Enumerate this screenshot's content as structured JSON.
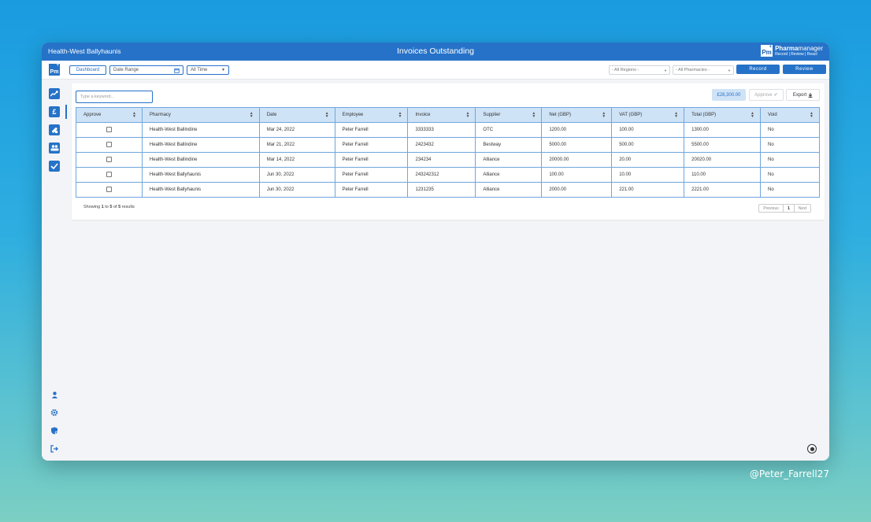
{
  "window": {
    "org": "Health-West Ballyhaunis",
    "title": "Invoices Outstanding",
    "brand": {
      "name_bold": "Pharma",
      "name_rest": "manager",
      "tagline": "Record | Review | React",
      "logo": "Pm"
    }
  },
  "toolbar": {
    "dashboard_label": "Dashboard",
    "date_range_placeholder": "Date Range",
    "time_filter": "All Time",
    "regions_filter": "- All Regions -",
    "pharmacies_filter": "- All Pharmacies -",
    "record_label": "Record",
    "review_label": "Review"
  },
  "sidebar": {
    "top_icons": [
      "trend-chart-icon",
      "pound-icon",
      "medicine-icon",
      "team-icon",
      "checkmark-icon"
    ],
    "bottom_icons": [
      "user-icon",
      "gear-icon",
      "shield-icon",
      "logout-icon"
    ]
  },
  "invoices": {
    "search_placeholder": "Type a keyword...",
    "total_amount": "£28,300.00",
    "approve_label": "Approve",
    "export_label": "Export",
    "columns": [
      "Approve",
      "Pharmacy",
      "Date",
      "Employee",
      "Invoice",
      "Supplier",
      "Net (GBP)",
      "VAT (GBP)",
      "Total (GBP)",
      "Void"
    ],
    "rows": [
      {
        "pharmacy": "Health-West Ballindine",
        "date": "Mar 24, 2022",
        "employee": "Peter Farrell",
        "invoice": "3333333",
        "supplier": "OTC",
        "net": "1200.00",
        "vat": "100.00",
        "total": "1300.00",
        "void": "No"
      },
      {
        "pharmacy": "Health-West Ballindine",
        "date": "Mar 21, 2022",
        "employee": "Peter Farrell",
        "invoice": "2423432",
        "supplier": "Bestway",
        "net": "5000.00",
        "vat": "500.00",
        "total": "5500.00",
        "void": "No"
      },
      {
        "pharmacy": "Health-West Ballindine",
        "date": "Mar 14, 2022",
        "employee": "Peter Farrell",
        "invoice": "234234",
        "supplier": "Alliance",
        "net": "20000.00",
        "vat": "20.00",
        "total": "20020.00",
        "void": "No"
      },
      {
        "pharmacy": "Health-West Ballyhaunis",
        "date": "Jun 30, 2022",
        "employee": "Peter Farrell",
        "invoice": "243242312",
        "supplier": "Alliance",
        "net": "100.00",
        "vat": "10.00",
        "total": "110.00",
        "void": "No"
      },
      {
        "pharmacy": "Health-West Ballyhaunis",
        "date": "Jun 30, 2022",
        "employee": "Peter Farrell",
        "invoice": "1231235",
        "supplier": "Alliance",
        "net": "2000.00",
        "vat": "221.00",
        "total": "2221.00",
        "void": "No"
      }
    ],
    "showing": {
      "prefix": "Showing",
      "from": "1",
      "to_word": "to",
      "to": "5",
      "of_word": "of",
      "total": "5",
      "suffix": "results"
    },
    "pagination": {
      "previous": "Previous",
      "page": "1",
      "next": "Next"
    }
  },
  "watermark": "@Peter_Farrell27",
  "colors": {
    "primary": "#2672c8",
    "header_bg": "#cfe3f7",
    "border": "#6fa6dd"
  }
}
